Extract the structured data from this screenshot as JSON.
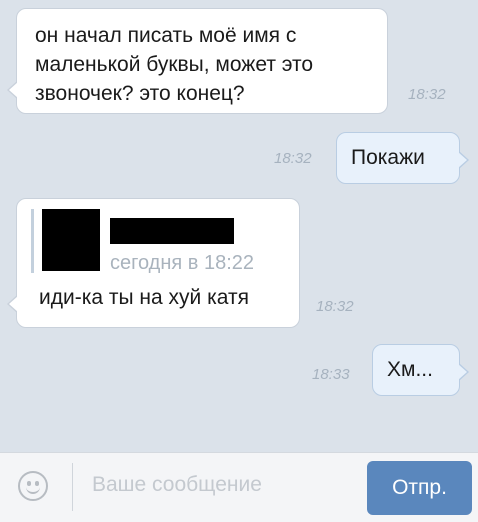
{
  "messages": [
    {
      "text": "он начал писать моё имя с\nмаленькой буквы, может это\nзвоночек? это конец?",
      "time": "18:32"
    },
    {
      "text": "Покажи",
      "time": "18:32"
    },
    {
      "quote_date": "сегодня в 18:22",
      "text": "иди-ка ты на хуй катя",
      "time": "18:32"
    },
    {
      "text": "Хм...",
      "time": "18:33"
    }
  ],
  "composer": {
    "placeholder": "Ваше сообщение",
    "send_label": "Отпр.",
    "emoji_icon": "smile-icon"
  },
  "colors": {
    "chat_bg": "#dbe2ea",
    "incoming_bubble": "#ffffff",
    "outgoing_bubble": "#e8f1fb",
    "send_button": "#5a87bd",
    "time_text": "#a6b2bf"
  }
}
